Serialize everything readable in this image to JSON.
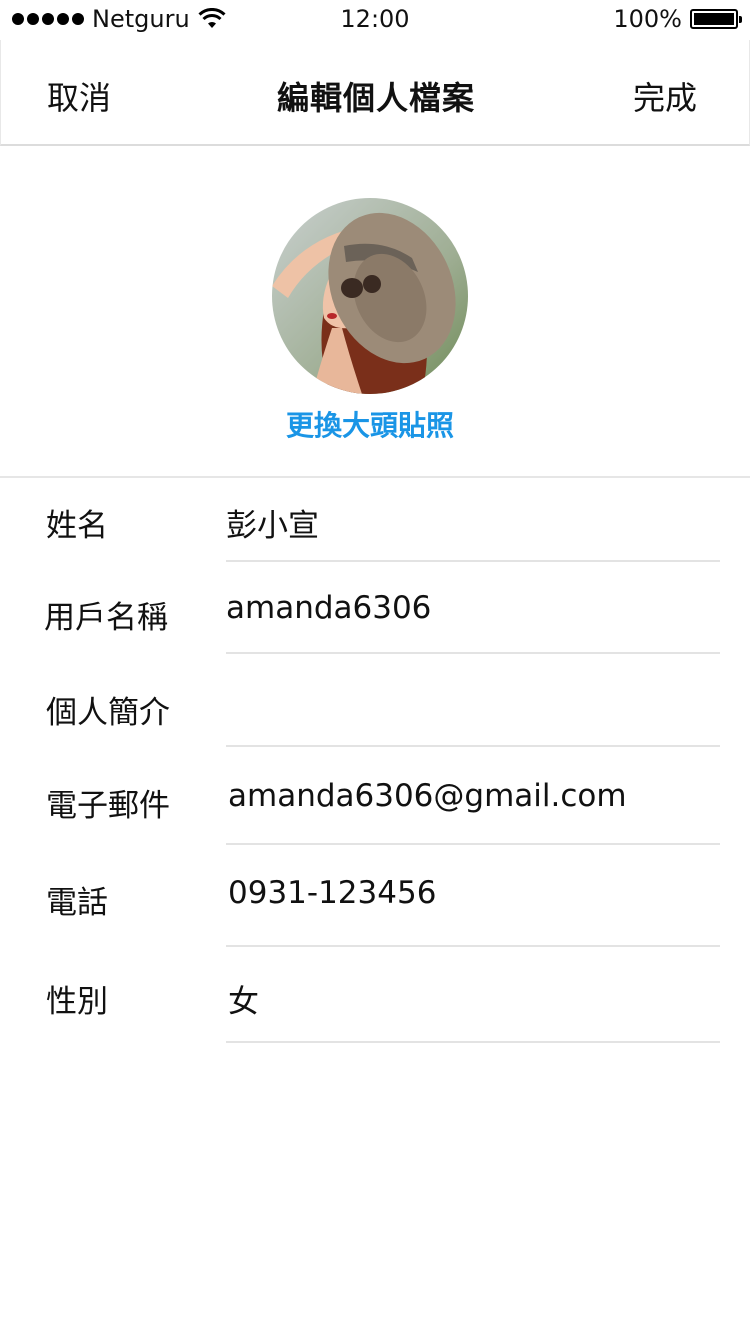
{
  "status_bar": {
    "carrier": "Netguru",
    "time": "12:00",
    "battery": "100%"
  },
  "nav": {
    "cancel": "取消",
    "title": "編輯個人檔案",
    "done": "完成"
  },
  "profile": {
    "change_photo": "更換大頭貼照",
    "accent_color": "#1a95e6"
  },
  "fields": [
    {
      "label": "姓名",
      "value": "彭小宣"
    },
    {
      "label": "用戶名稱",
      "value": "amanda6306"
    },
    {
      "label": "個人簡介",
      "value": ""
    },
    {
      "label": "電子郵件",
      "value": "amanda6306@gmail.com"
    },
    {
      "label": "電話",
      "value": "0931-123456"
    },
    {
      "label": "性別",
      "value": "女"
    }
  ]
}
